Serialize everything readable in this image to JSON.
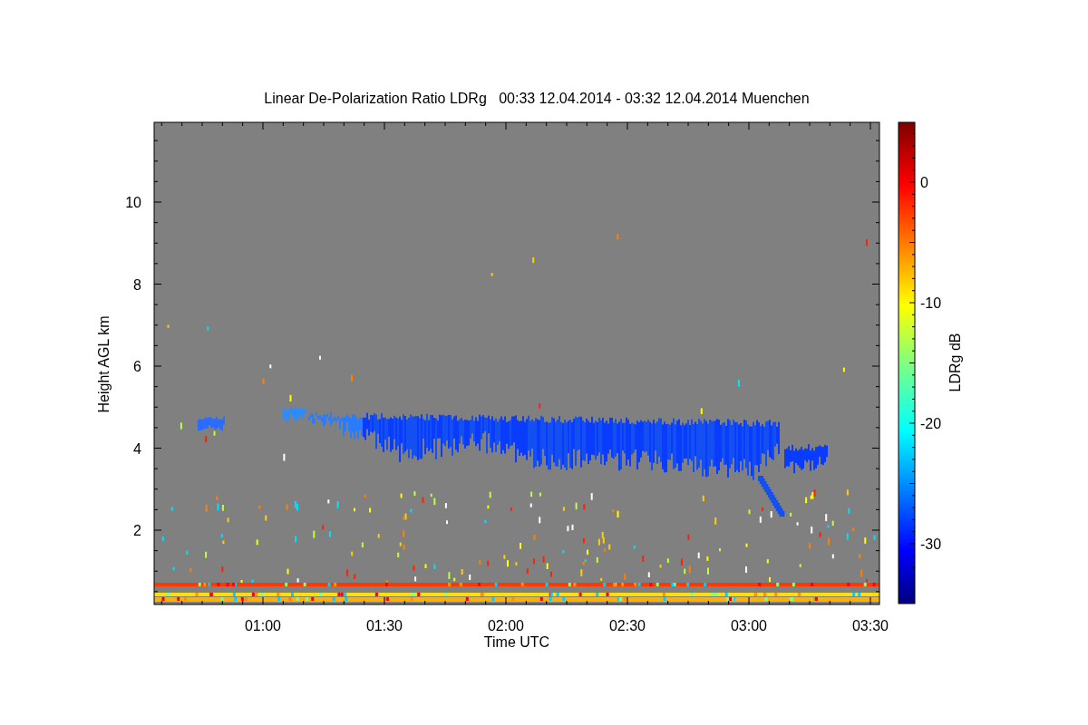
{
  "plot": {
    "title": "Linear De-Polarization Ratio LDRg   00:33 12.04.2014 - 03:32 12.04.2014 Muenchen",
    "xlabel": "Time UTC",
    "ylabel": "Height AGL km",
    "xticks": [
      "01:00",
      "01:30",
      "02:00",
      "02:30",
      "03:00",
      "03:30"
    ],
    "yticks": [
      "10",
      "8",
      "6",
      "4",
      "2"
    ]
  },
  "colorbar": {
    "label": "LDRg dB",
    "ticks": [
      "0",
      "-10",
      "-20",
      "-30"
    ]
  }
}
